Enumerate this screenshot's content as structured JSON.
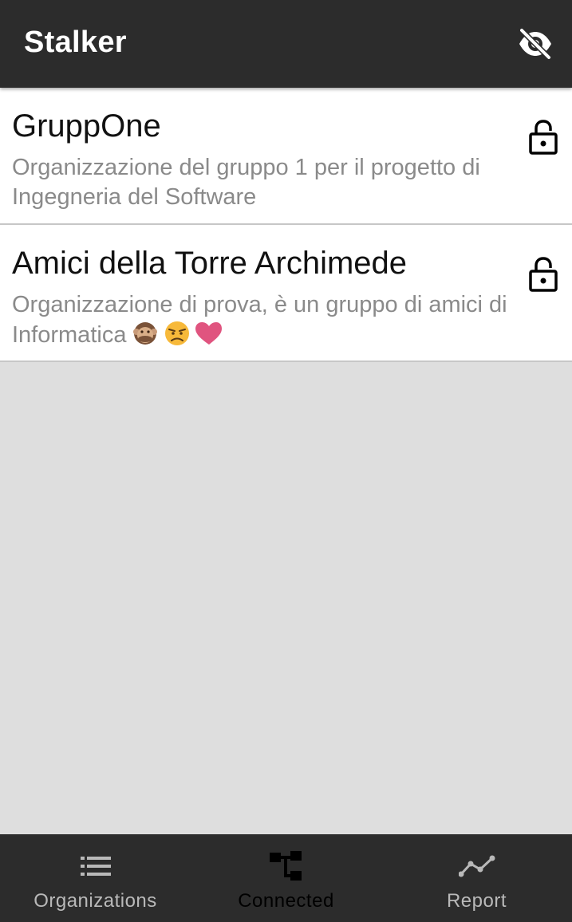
{
  "app": {
    "title": "Stalker",
    "toggle_icon": "eye-off-icon"
  },
  "organizations": [
    {
      "name": "GruppOne",
      "description": "Organizzazione del gruppo 1 per il progetto di Ingegneria del Software",
      "emojis": "",
      "status_icon": "lock-open-icon"
    },
    {
      "name": "Amici della Torre Archimede",
      "description": "Organizzazione di prova, è un gruppo di amici di Informatica",
      "emojis": "🙊😠❤",
      "status_icon": "lock-open-icon"
    }
  ],
  "bottom_nav": {
    "items": [
      {
        "label": "Organizations",
        "icon": "list-icon",
        "active": false
      },
      {
        "label": "Connected",
        "icon": "hierarchy-icon",
        "active": true
      },
      {
        "label": "Report",
        "icon": "trend-line-icon",
        "active": false
      }
    ]
  },
  "colors": {
    "appbar": "#2c2c2c",
    "background": "#dedede",
    "nav_inactive": "#b9b9b9",
    "nav_active": "#000000",
    "description_text": "#8a8a8a"
  }
}
